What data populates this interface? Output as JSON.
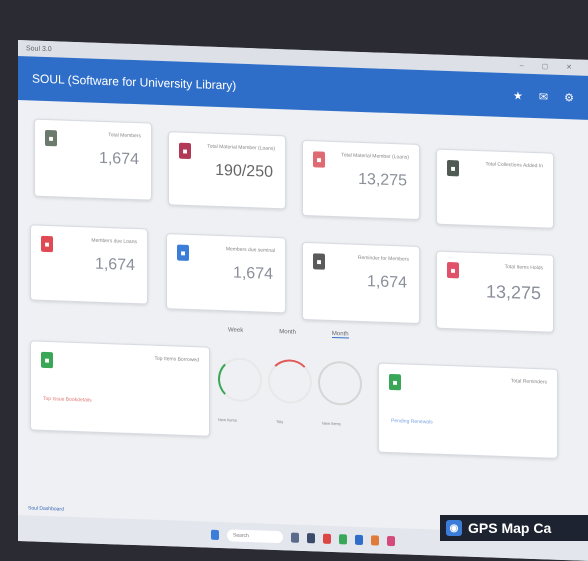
{
  "window": {
    "title_small": "Soul 3.0"
  },
  "app": {
    "title": "SOUL (Software for University Library)",
    "right_icons": [
      "★",
      "✉",
      "⚙"
    ]
  },
  "cards": [
    {
      "label": "Total Members",
      "value": "1,674",
      "color": "#6b7a6d"
    },
    {
      "label": "Total Material Member (Loans)",
      "value": "190/250",
      "color": "#b33a56"
    },
    {
      "label": "Total Material Member (Loans)",
      "value": "13,275",
      "color": "#e06a74"
    },
    {
      "label": "Total Collections Added In",
      "value": "",
      "color": "#4f5a52"
    },
    {
      "label": "Members due Loans",
      "value": "1,674",
      "color": "#e04a54"
    },
    {
      "label": "Members due seminal",
      "value": "1,674",
      "color": "#3b7dd8"
    },
    {
      "label": "Reminder for Members",
      "value": "1,674",
      "color": "#5a5a5a"
    },
    {
      "label": "Total Items Holds",
      "value": "13,275",
      "color": "#e0526a"
    }
  ],
  "tabs": [
    "Week",
    "Month",
    "Month"
  ],
  "bottom_left_card": {
    "label": "Top Items Borrowed",
    "link": "Top Issue Bookdetails"
  },
  "bottom_right_card": {
    "label": "Total Reminders",
    "link": "Pending Renewals"
  },
  "donuts": [
    "New Items",
    "Title",
    "New Items"
  ],
  "footer": "Soul Dashboard",
  "taskbar": {
    "search": "Search"
  },
  "overlay": "GPS Map Ca"
}
